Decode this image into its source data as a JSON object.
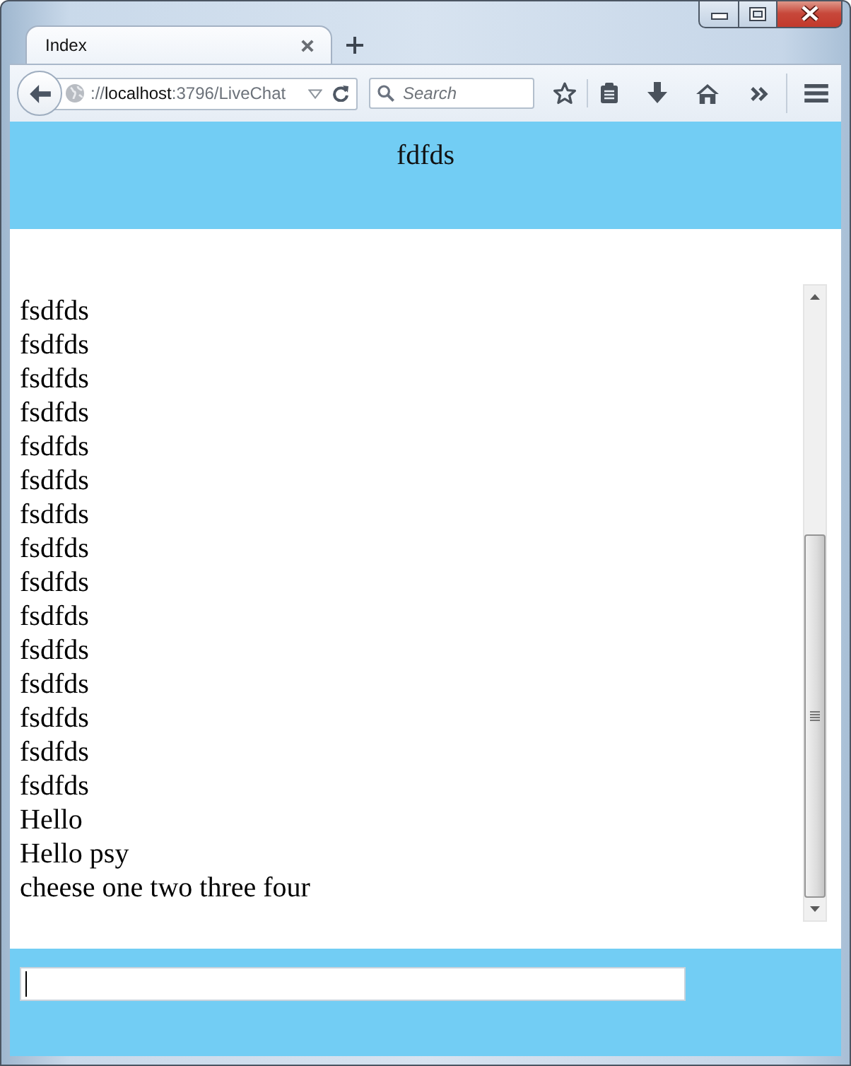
{
  "browser": {
    "tabs": [
      {
        "label": "Index",
        "selected": true
      }
    ],
    "address": "://**localhost**:3796/LiveChat",
    "search": {
      "placeholder": "Search"
    }
  },
  "page": {
    "header": "fdfds",
    "messages": [
      "fsdfds",
      "fsdfds",
      "fsdfds",
      "fsdfds",
      "fsdfds",
      "fsdfds",
      "fsdfds",
      "fsdfds",
      "fsdfds",
      "fsdfds",
      "fsdfds",
      "fsdfds",
      "fsdfds",
      "fsdfds",
      "fsdfds",
      "Hello",
      "Hello psy",
      "cheese one two three four"
    ]
  }
}
